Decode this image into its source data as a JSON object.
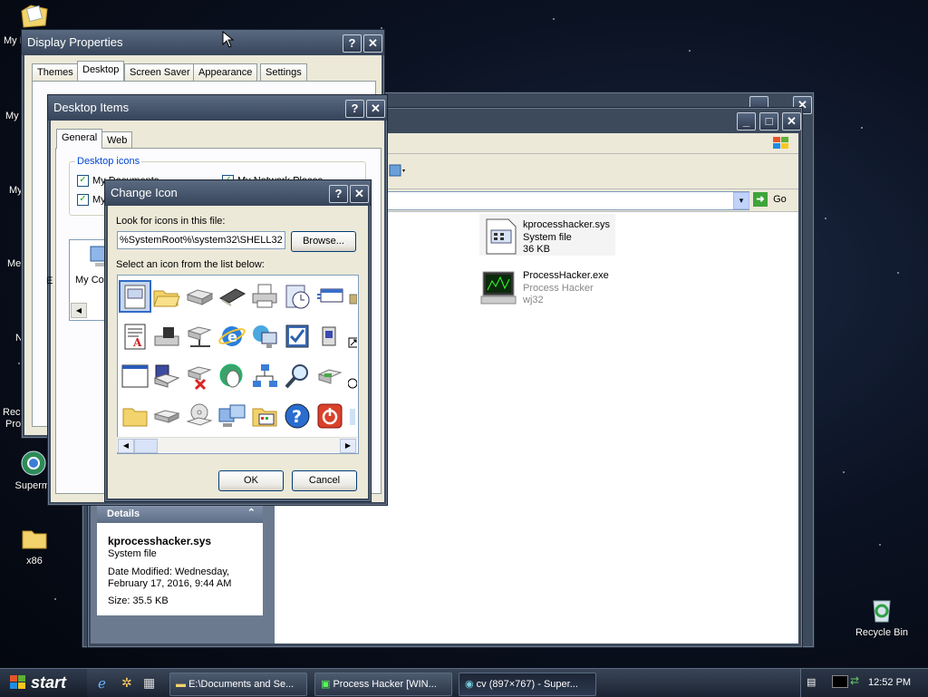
{
  "desktop": {
    "icons": [
      {
        "name": "My Documents",
        "label": "My I"
      },
      {
        "name": "My Computer",
        "label": "My"
      },
      {
        "name": "My Network Places",
        "label": "My"
      },
      {
        "name": "Media",
        "label": "Me"
      },
      {
        "name": "Network",
        "label": "N"
      },
      {
        "name": "Recycle Process",
        "label1": "Rec",
        "label2": "Pro"
      }
    ],
    "supermium_label": "Supermi",
    "x86_label": "x86",
    "recycle_bin_label": "Recycle Bin"
  },
  "display_properties": {
    "title": "Display Properties",
    "tabs": [
      "Themes",
      "Desktop",
      "Screen Saver",
      "Appearance",
      "Settings"
    ],
    "active_tab": "Desktop"
  },
  "desktop_items": {
    "title": "Desktop Items",
    "tabs": [
      "General",
      "Web"
    ],
    "group_label": "Desktop icons",
    "checkboxes": [
      {
        "label": "My Documents",
        "checked": true
      },
      {
        "label": "My Network Places",
        "checked": true
      },
      {
        "label": "My",
        "checked": true
      }
    ],
    "icon_preview_label": "My Co",
    "side_label": "E"
  },
  "change_icon": {
    "title": "Change Icon",
    "look_label": "Look for icons in this file:",
    "path_value": "%SystemRoot%\\system32\\SHELL32",
    "browse_label": "Browse...",
    "select_label": "Select an icon from the list below:",
    "ok_label": "OK",
    "cancel_label": "Cancel"
  },
  "explorer": {
    "go_label": "Go",
    "files": [
      {
        "name": "kprocesshacker.sys",
        "type": "System file",
        "size": "36 KB"
      },
      {
        "name": "ProcessHacker.exe",
        "type": "Process Hacker",
        "size": "wj32"
      }
    ],
    "details": {
      "header": "Details",
      "name": "kprocesshacker.sys",
      "type": "System file",
      "modified": "Date Modified: Wednesday, February 17, 2016, 9:44 AM",
      "size": "Size: 35.5 KB"
    }
  },
  "taskbar": {
    "start_label": "start",
    "tasks": [
      {
        "label": "E:\\Documents and Se...",
        "active": false
      },
      {
        "label": "Process Hacker [WIN...",
        "active": false
      },
      {
        "label": "cv (897×767) - Super...",
        "active": true
      }
    ],
    "clock": "12:52 PM"
  },
  "colors": {
    "title_bar": "#3d4a5c",
    "selection": "#316ac5",
    "dialog_face": "#ece9d8"
  }
}
